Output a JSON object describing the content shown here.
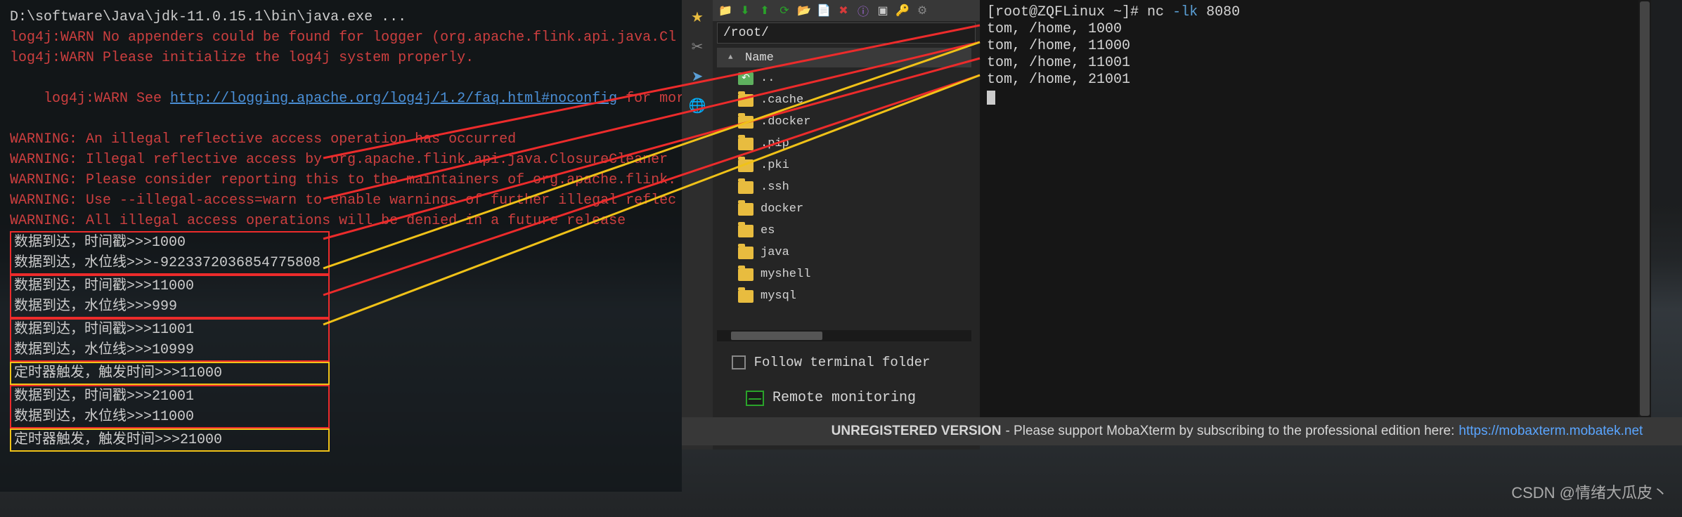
{
  "left_terminal": {
    "cmd": "D:\\software\\Java\\jdk-11.0.15.1\\bin\\java.exe ...",
    "warn1": "log4j:WARN No appenders could be found for logger (org.apache.flink.api.java.Cl",
    "warn2": "log4j:WARN Please initialize the log4j system properly.",
    "warn3_pre": "log4j:WARN See ",
    "warn3_link": "http://logging.apache.org/log4j/1.2/faq.html#noconfig",
    "warn3_post": " for more i",
    "w1": "WARNING: An illegal reflective access operation has occurred",
    "w2": "WARNING: Illegal reflective access by org.apache.flink.api.java.ClosureCleaner ",
    "w3": "WARNING: Please consider reporting this to the maintainers of org.apache.flink.",
    "w4": "WARNING: Use --illegal-access=warn to enable warnings of further illegal reflec",
    "w5": "WARNING: All illegal access operations will be denied in a future release",
    "boxes": [
      {
        "l1": "数据到达，时间戳>>>1000",
        "l2": "数据到达，水位线>>>-9223372036854775808",
        "cls": "box-red"
      },
      {
        "l1": "数据到达，时间戳>>>11000",
        "l2": "数据到达，水位线>>>999",
        "cls": "box-red"
      },
      {
        "l1": "数据到达，时间戳>>>11001",
        "l2": "数据到达，水位线>>>10999",
        "cls": "box-red"
      },
      {
        "l1": "定时器触发，触发时间>>>11000",
        "cls": "box-yellow"
      },
      {
        "l1": "数据到达，时间戳>>>21001",
        "l2": "数据到达，水位线>>>11000",
        "cls": "box-red"
      },
      {
        "l1": "定时器触发，触发时间>>>21000",
        "cls": "box-yellow"
      }
    ]
  },
  "center_panel": {
    "path": "/root/",
    "col_name": "Name",
    "up": "..",
    "folders": [
      ".cache",
      ".docker",
      ".pip",
      ".pki",
      ".ssh",
      "docker",
      "es",
      "java",
      "myshell",
      "mysql"
    ],
    "follow": "Follow terminal folder",
    "remote": "Remote monitoring",
    "sidebar_icons": [
      "star",
      "scissors",
      "send",
      "globe"
    ],
    "toolbar_icons": [
      "folder",
      "download",
      "upload",
      "refresh",
      "newfolder",
      "file",
      "delete",
      "props",
      "terminal",
      "key",
      "settings"
    ]
  },
  "right_terminal": {
    "prompt_user": "[root@ZQFLinux ~]# ",
    "cmd_nc": "nc ",
    "cmd_flag": "-lk",
    "cmd_port": " 8080",
    "lines": [
      "tom, /home, 1000",
      "tom, /home, 11000",
      "tom, /home, 11001",
      "tom, /home, 21001"
    ]
  },
  "unreg": {
    "bold": "UNREGISTERED VERSION",
    "text": " -  Please support MobaXterm by subscribing to the professional edition here:  ",
    "link": "https://mobaxterm.mobatek.net"
  },
  "watermark": "CSDN @情绪大瓜皮丶",
  "icon_colors": {
    "star": "#e8bc3f",
    "scissors": "#888",
    "send": "#5a9fd6",
    "globe": "#d66a2a",
    "folder": "#e8bc3f",
    "download": "#2aa32a",
    "upload": "#2aa32a",
    "refresh": "#2aa32a",
    "newfolder": "#5a9fd6",
    "file": "#eee",
    "delete": "#d63a3a",
    "props": "#a56add",
    "terminal": "#ccc",
    "key": "#888",
    "settings": "#888"
  },
  "chart_data": null
}
